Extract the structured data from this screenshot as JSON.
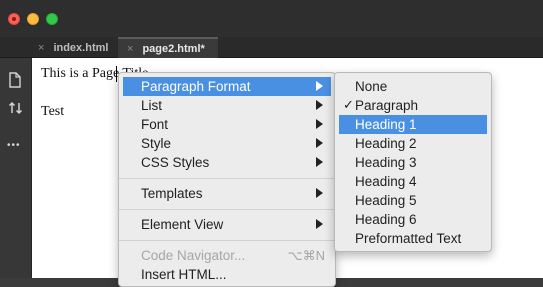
{
  "tabs": [
    {
      "label": "index.html",
      "close": "×"
    },
    {
      "label": "page2.html*",
      "close": "×"
    }
  ],
  "sidebar": {
    "icons": [
      "file-icon",
      "sort-icon",
      "more-icon"
    ],
    "more_glyph": "•••"
  },
  "editor": {
    "lines": [
      "This is a Page Title",
      "Test"
    ]
  },
  "context_menu": {
    "items": [
      {
        "label": "Paragraph Format",
        "has_submenu": true,
        "highlighted": true
      },
      {
        "label": "List",
        "has_submenu": true
      },
      {
        "label": "Font",
        "has_submenu": true
      },
      {
        "label": "Style",
        "has_submenu": true
      },
      {
        "label": "CSS Styles",
        "has_submenu": true
      },
      {
        "label": "Templates",
        "has_submenu": true
      },
      {
        "label": "Element View",
        "has_submenu": true
      },
      {
        "label": "Code Navigator...",
        "shortcut": "⌥⌘N",
        "disabled": true
      },
      {
        "label": "Insert HTML..."
      }
    ]
  },
  "submenu": {
    "items": [
      {
        "label": "None"
      },
      {
        "label": "Paragraph",
        "checked": true,
        "check_glyph": "✓"
      },
      {
        "label": "Heading 1",
        "highlighted": true
      },
      {
        "label": "Heading 2"
      },
      {
        "label": "Heading 3"
      },
      {
        "label": "Heading 4"
      },
      {
        "label": "Heading 5"
      },
      {
        "label": "Heading 6"
      },
      {
        "label": "Preformatted Text"
      }
    ]
  },
  "colors": {
    "highlight": "#4a90e2",
    "menu_bg": "#ececec",
    "chrome": "#2e2e2e"
  }
}
